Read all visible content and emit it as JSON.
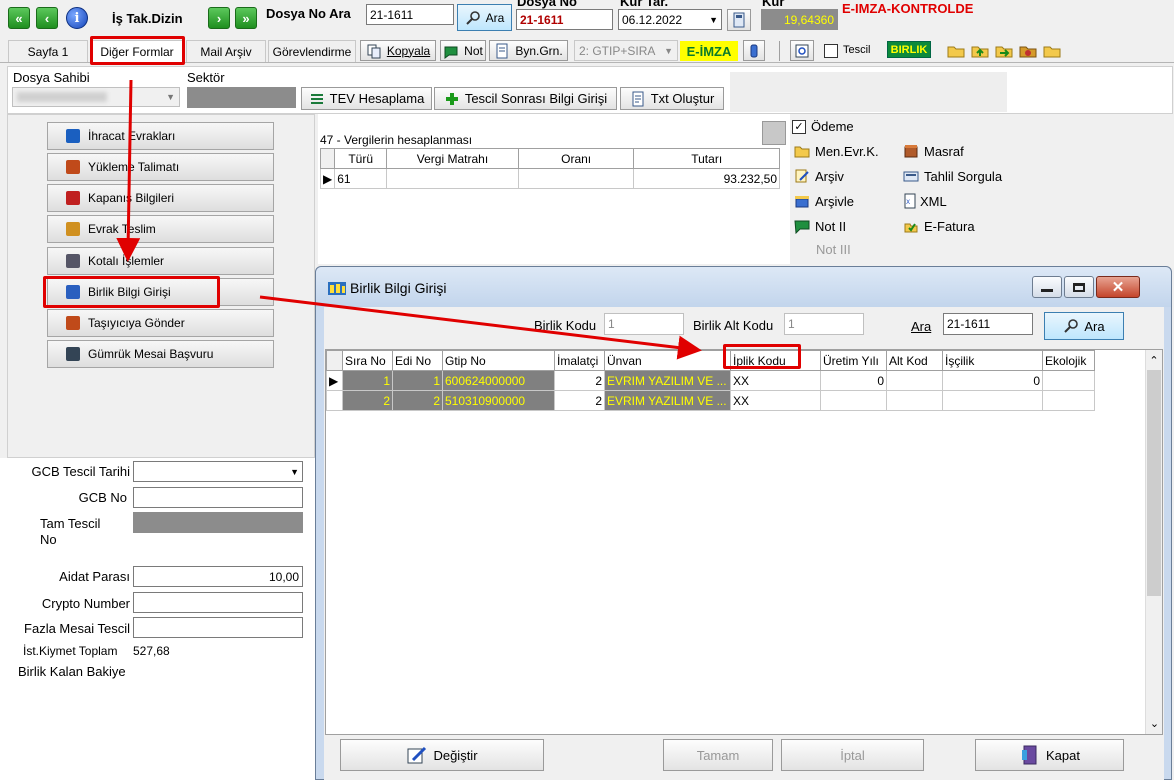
{
  "toolbar": {
    "title": "İş Tak.Dizin",
    "search_label": "Dosya No Ara",
    "search_value": "21-1611",
    "search_button": "Ara",
    "file_no_label": "Dosya No",
    "file_no_value": "21-1611",
    "rate_date_label": "Kur Tar.",
    "rate_date_value": "06.12.2022",
    "rate_label": "Kur",
    "rate_value": "19,64360",
    "status_text": "E-IMZA-KONTROLDE"
  },
  "tabs": [
    "Sayfa 1",
    "Diğer Formlar",
    "Mail Arşiv",
    "Görevlendirme"
  ],
  "tool_buttons": {
    "copy": "Kopyala",
    "note": "Not",
    "byn": "Byn.Grn.",
    "combo": "2: GTIP+SIRA",
    "eimza": "E-İMZA",
    "tescil": "Tescil",
    "birlik": "BIRLIK"
  },
  "filter_row": {
    "owner_label": "Dosya Sahibi",
    "sector_label": "Sektör",
    "btn_tev": "TEV Hesaplama",
    "btn_tescil": "Tescil Sonrası Bilgi Girişi",
    "btn_txt": "Txt Oluştur"
  },
  "side_menu": [
    "İhracat Evrakları",
    "Yükleme Talimatı",
    "Kapanış Bilgileri",
    "Evrak Teslim",
    "Kotalı İşlemler",
    "Birlik Bilgi Girişi",
    "Taşıyıcıya Gönder",
    "Gümrük Mesai Başvuru"
  ],
  "tax_table": {
    "title": "47 - Vergilerin hesaplanması",
    "headers": [
      "Türü",
      "Vergi Matrahı",
      "Oranı",
      "Tutarı"
    ],
    "row": [
      "61",
      "",
      "",
      "93.232,50"
    ]
  },
  "right_links": {
    "odeme": "Ödeme",
    "men_evr": "Men.Evr.K.",
    "masraf": "Masraf",
    "arsiv": "Arşiv",
    "tahlil": "Tahlil Sorgula",
    "arsivle": "Arşivle",
    "xml": "XML",
    "not2": "Not II",
    "efatura": "E-Fatura",
    "not3": "Not III"
  },
  "lower_form": {
    "gcb_tarih": "GCB Tescil Tarihi",
    "gcb_no": "GCB No",
    "tam_tescil": "Tam Tescil",
    "tam_tescil_2": "No",
    "aidat": "Aidat Parası",
    "aidat_value": "10,00",
    "crypto": "Crypto Number",
    "fazla_mesai": "Fazla Mesai Tescil",
    "ist_kiymet": "İst.Kiymet Toplam",
    "ist_kiymet_value": "527,68",
    "birlik_kalan": "Birlik Kalan Bakiye"
  },
  "dialog": {
    "title": "Birlik Bilgi Girişi",
    "birlik_kodu_label": "Birlik Kodu",
    "birlik_kodu_value": "1",
    "alt_kod_label": "Birlik Alt Kodu",
    "alt_kod_value": "1",
    "ara_label": "Ara",
    "ara_value": "21-1611",
    "ara_button": "Ara",
    "headers": [
      "Sıra No",
      "Edi No",
      "Gtip No",
      "İmalatçi",
      "Ünvan",
      "İplik Kodu",
      "Üretim Yılı",
      "Alt Kod",
      "İşçilik",
      "Ekolojik"
    ],
    "rows": [
      [
        "1",
        "1",
        "600624000000",
        "2",
        "EVRIM YAZILIM VE ...",
        "XX",
        "0",
        "",
        "0",
        ""
      ],
      [
        "2",
        "2",
        "510310900000",
        "2",
        "EVRIM YAZILIM VE ...",
        "XX",
        "",
        "",
        "",
        ""
      ]
    ],
    "btn_degistir": "Değiştir",
    "btn_tamam": "Tamam",
    "btn_iptal": "İptal",
    "btn_kapat": "Kapat"
  },
  "colors": {
    "accent_red": "#e00000",
    "eimza_bg": "#ffff00",
    "birlik_bg": "#0c8a3a",
    "grid_gray": "#808080",
    "grid_yellow": "#ffff00"
  }
}
